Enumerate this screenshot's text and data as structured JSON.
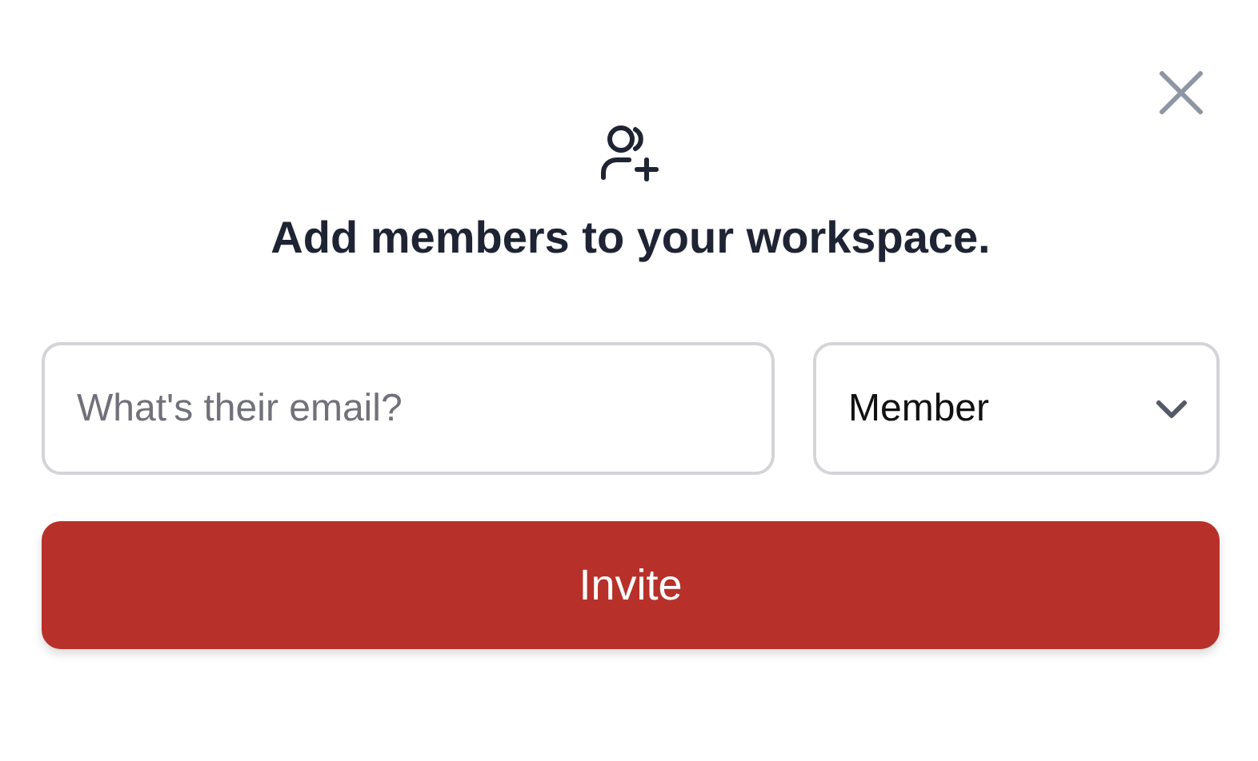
{
  "title": "Add members to your workspace.",
  "email": {
    "placeholder": "What's their email?"
  },
  "role": {
    "value": "Member"
  },
  "invite_button": "Invite"
}
